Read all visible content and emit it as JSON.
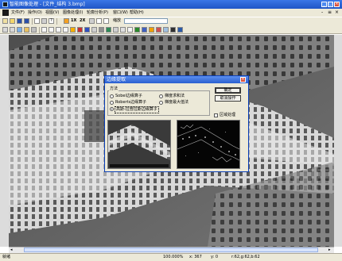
{
  "window": {
    "title": "智能图像处理 - [文件_结构 3.bmp]",
    "minimize": "_",
    "maximize": "□",
    "close": "×"
  },
  "menu": {
    "items": [
      "文件(F)",
      "操作(O)",
      "视图(V)",
      "图像处理(I)",
      "轮廓分析(P)",
      "窗口(W)",
      "帮助(H)"
    ],
    "mdi_buttons": [
      "-",
      "≡",
      "×"
    ]
  },
  "toolbar": {
    "zoom_in_label": "1X",
    "zoom_2x_label": "2X",
    "zoom_value": "缩放"
  },
  "dialog": {
    "title": "边缘提取",
    "close": "×",
    "group_label": "方法",
    "options": [
      {
        "label": "Sobel边缘算子",
        "selected": false
      },
      {
        "label": "Roberts边缘算子",
        "selected": false
      },
      {
        "label": "高斯-拉普拉斯边缘算子",
        "selected": true
      },
      {
        "label": "梯度求和法",
        "selected": false
      },
      {
        "label": "梯度最大值法",
        "selected": false
      }
    ],
    "ok_label": "确定",
    "cancel_label": "取消操作",
    "region_label": "区域处理",
    "region_checked": false
  },
  "status": {
    "left": "就绪",
    "zoom": "100.000%",
    "x": "x: 367",
    "y": "y: 0",
    "rgb": "r:62,g:62,b:62"
  }
}
